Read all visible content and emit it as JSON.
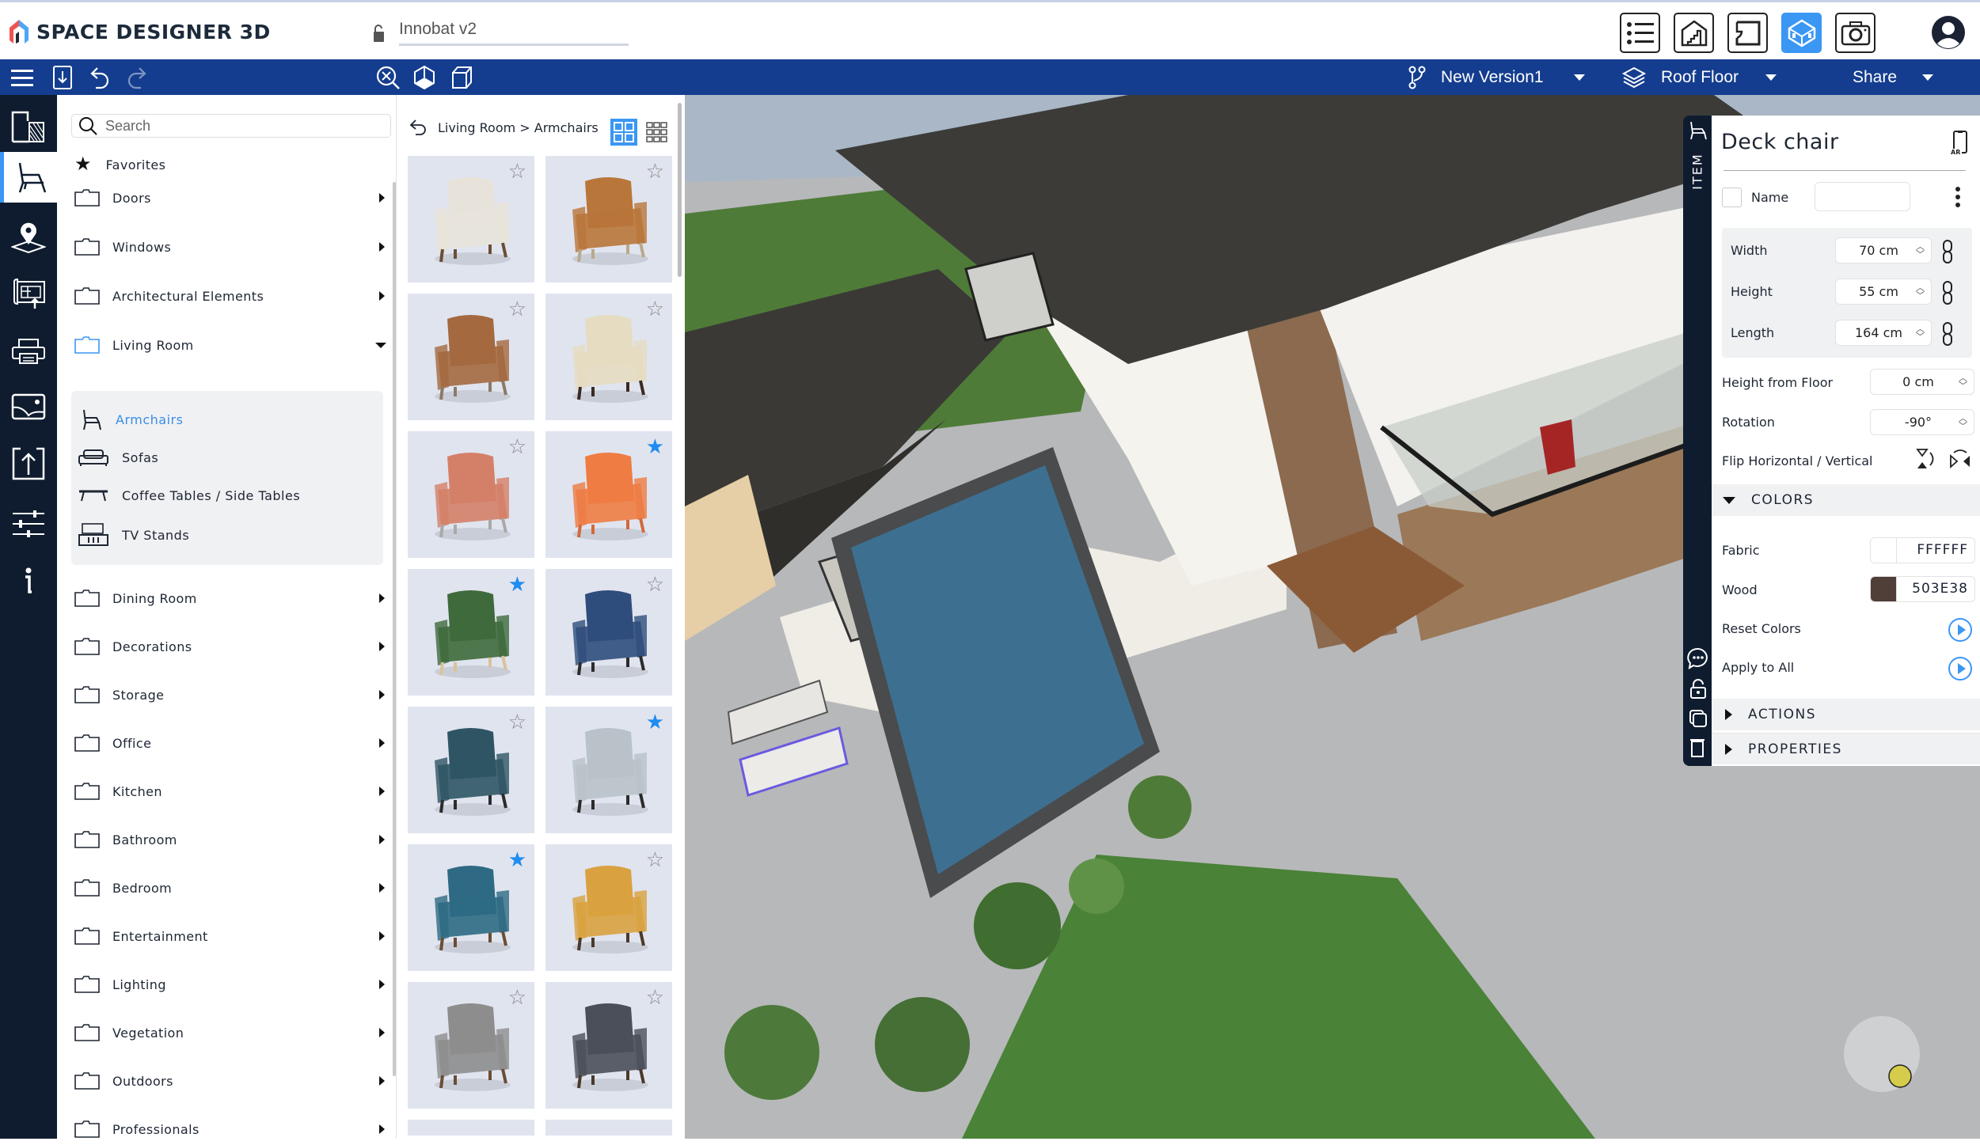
{
  "app": {
    "brand": "SPACE DESIGNER 3D",
    "project_name": "Innobat v2",
    "lock_state": "unlocked"
  },
  "header": {
    "view_buttons": [
      {
        "name": "list-view",
        "icon": "list-icon",
        "active": false
      },
      {
        "name": "elevation-view",
        "icon": "house-stairs-icon",
        "active": false
      },
      {
        "name": "2d-plan-view",
        "icon": "floorplan-icon",
        "active": false
      },
      {
        "name": "3d-view",
        "icon": "cube-room-icon",
        "active": true
      },
      {
        "name": "snapshot",
        "icon": "camera-icon",
        "active": false
      }
    ],
    "user_icon": "user-avatar-icon"
  },
  "toolbar": {
    "left_icons": [
      "menu-icon",
      "download-icon",
      "undo-icon",
      "redo-icon"
    ],
    "center_icons": [
      "zoom-fit-icon",
      "cube-solid-icon",
      "cube-wireframe-icon"
    ],
    "version": "New Version1",
    "floor": "Roof Floor",
    "share": "Share"
  },
  "rail": {
    "items": [
      {
        "name": "walls-rooms",
        "icon": "walls-icon",
        "active": false
      },
      {
        "name": "furniture",
        "icon": "chair-icon",
        "active": true
      },
      {
        "name": "location",
        "icon": "map-pin-icon",
        "active": false
      },
      {
        "name": "import-plan",
        "icon": "blueprint-upload-icon",
        "active": false
      },
      {
        "name": "print",
        "icon": "printer-icon",
        "active": false
      },
      {
        "name": "terrain",
        "icon": "landscape-icon",
        "active": false
      },
      {
        "name": "export",
        "icon": "upload-icon",
        "active": false
      },
      {
        "name": "settings",
        "icon": "sliders-icon",
        "active": false
      },
      {
        "name": "info",
        "icon": "info-icon",
        "active": false
      }
    ]
  },
  "catalog": {
    "search_placeholder": "Search",
    "favorites": "Favorites",
    "categories_top": [
      {
        "label": "Doors",
        "expanded": false
      },
      {
        "label": "Windows",
        "expanded": false
      },
      {
        "label": "Architectural Elements",
        "expanded": false
      },
      {
        "label": "Living Room",
        "expanded": true
      }
    ],
    "living_room_sub": [
      {
        "label": "Armchairs",
        "icon": "armchair-icon",
        "active": true
      },
      {
        "label": "Sofas",
        "icon": "sofa-icon",
        "active": false
      },
      {
        "label": "Coffee Tables / Side Tables",
        "icon": "coffee-table-icon",
        "active": false
      },
      {
        "label": "TV Stands",
        "icon": "tv-stand-icon",
        "active": false
      }
    ],
    "categories_bottom": [
      {
        "label": "Dining Room"
      },
      {
        "label": "Decorations"
      },
      {
        "label": "Storage"
      },
      {
        "label": "Office"
      },
      {
        "label": "Kitchen"
      },
      {
        "label": "Bathroom"
      },
      {
        "label": "Bedroom"
      },
      {
        "label": "Entertainment"
      },
      {
        "label": "Lighting"
      },
      {
        "label": "Vegetation"
      },
      {
        "label": "Outdoors"
      },
      {
        "label": "Professionals"
      }
    ]
  },
  "grid": {
    "breadcrumb": "Living Room > Armchairs",
    "view_mode": "large",
    "items": [
      {
        "color": "#e8e3da",
        "frame": "#6a4e37",
        "favorite": false
      },
      {
        "color": "#b9763a",
        "frame": "#b9a88a",
        "favorite": false
      },
      {
        "color": "#a4693f",
        "frame": "#8a7a66",
        "favorite": false
      },
      {
        "color": "#e5dcc1",
        "frame": "#3b2a22",
        "favorite": false
      },
      {
        "color": "#d48068",
        "frame": "#a9a9a9",
        "favorite": false
      },
      {
        "color": "#ee7c43",
        "frame": "#d2693a",
        "favorite": true
      },
      {
        "color": "#3f6a3c",
        "frame": "#d9c29a",
        "favorite": true
      },
      {
        "color": "#2f4d7c",
        "frame": "#2c2c2c",
        "favorite": false
      },
      {
        "color": "#2f5564",
        "frame": "#2c2c2c",
        "favorite": false
      },
      {
        "color": "#b8c2c8",
        "frame": "#2c2c2c",
        "favorite": true
      },
      {
        "color": "#2e6a83",
        "frame": "#6b4d33",
        "favorite": true
      },
      {
        "color": "#d9a13f",
        "frame": "#4a3a2b",
        "favorite": false
      },
      {
        "color": "#8d8d8d",
        "frame": "#6b4d33",
        "favorite": false
      },
      {
        "color": "#4a4f59",
        "frame": "#4a3a2b",
        "favorite": false
      }
    ],
    "star_filled_color": "#1f8cf0"
  },
  "properties": {
    "tab_label": "ITEM",
    "title": "Deck chair",
    "ar_icon": "ar-phone-icon",
    "name_label": "Name",
    "name_value": "",
    "width_label": "Width",
    "width_value": "70 cm",
    "height_label": "Height",
    "height_value": "55 cm",
    "length_label": "Length",
    "length_value": "164 cm",
    "height_floor_label": "Height from Floor",
    "height_floor_value": "0 cm",
    "rotation_label": "Rotation",
    "rotation_value": "-90°",
    "flip_label": "Flip Horizontal / Vertical",
    "colors_section": "COLORS",
    "colors": [
      {
        "label": "Fabric",
        "hex": "FFFFFF",
        "swatch": "#FFFFFF"
      },
      {
        "label": "Wood",
        "hex": "503E38",
        "swatch": "#503E38"
      }
    ],
    "reset_colors": "Reset Colors",
    "apply_all": "Apply to All",
    "actions_section": "ACTIONS",
    "properties_section": "PROPERTIES",
    "side_icons": [
      "comment-icon",
      "lock-open-icon",
      "duplicate-icon",
      "trash-icon"
    ]
  },
  "theme": {
    "accent": "#3a97f4",
    "toolbar_bg": "#143d8f",
    "rail_bg": "#0f1c2f",
    "joystick_knob": "#d4cc4a"
  }
}
